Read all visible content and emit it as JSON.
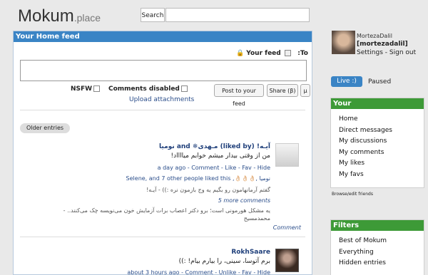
{
  "header": {
    "logo_main": "Mokum",
    "logo_suffix": ".place",
    "search_button": "Search",
    "search_placeholder": ""
  },
  "feed": {
    "title": "Your Home feed",
    "to_label": ":To",
    "your_feed_label": "Your feed",
    "nsfw_label": "NSFW",
    "comments_disabled_label": "Comments disabled",
    "post_button": "Post to your feed",
    "share_button": "Share (β)",
    "mu_button": "μ",
    "upload_link": "Upload attachments",
    "older_button": "Older entries"
  },
  "entries": [
    {
      "authors": "آیـه! (liked by) مـهدی❄ and نومیا",
      "text": "من از وقتی بیدار میشم خوابم میااااد!",
      "meta": "a day ago - Comment - Like - Fav - Hide",
      "liked_by": "Selene, and 7 other people liked this ,👌🏻👌🏻👌🏻, نومیا",
      "comment1": "گفتم آرمانهامون رو بگیم یه وج بازمون نره :)) - آیـه!",
      "more_comments": "5 more comments",
      "comment2": "یه مشکل هورمونی است؛ برو دکتر اعصاب برات آزمایش خون می‌نویسه چک می‌کنند.. -",
      "comment2_author": "محمدمسیح",
      "comment_link": "Comment"
    },
    {
      "author": "RokhSaare",
      "text": "برم آتوسا، سینی، را بیارم بیام! :))",
      "meta": "about 3 hours ago - Comment - Unlike - Fav - Hide"
    }
  ],
  "user": {
    "name": "MortezaDalil",
    "nick": "[mortezadalil]",
    "settings": "Settings",
    "signout": "Sign out"
  },
  "live": {
    "live_label": "Live :)",
    "paused_label": "Paused"
  },
  "your_panel": {
    "title": "Your",
    "items": [
      "Home",
      "Direct messages",
      "My discussions",
      "My comments",
      "My likes",
      "My favs"
    ]
  },
  "browse_label": "Browse/edit friends",
  "filters_panel": {
    "title": "Filters",
    "items": [
      "Best of Mokum",
      "Everything",
      "Hidden entries"
    ]
  }
}
